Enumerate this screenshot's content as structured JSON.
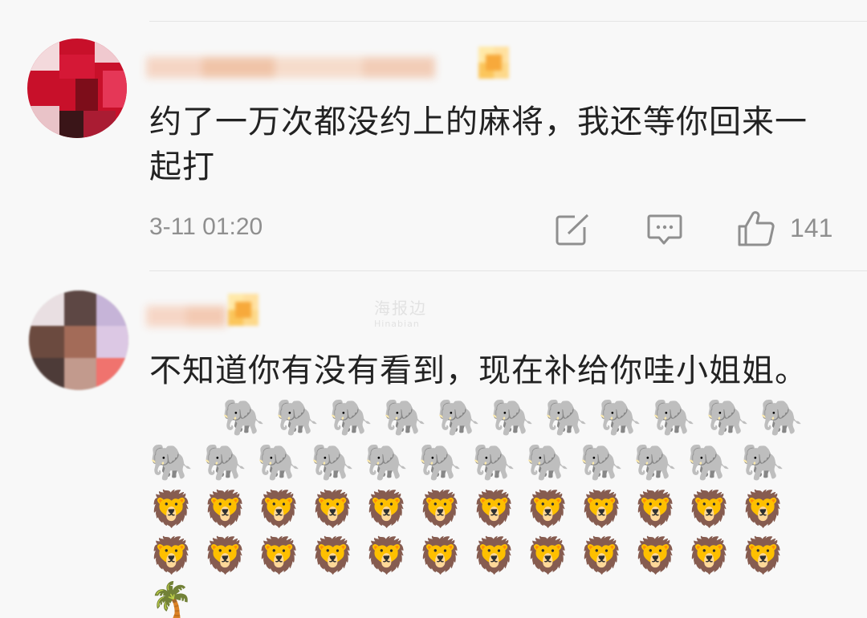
{
  "comments": [
    {
      "text": "约了一万次都没约上的麻将，我还等你回来一起打",
      "time": "3-11 01:20",
      "likes": "141"
    },
    {
      "text": "不知道你有没有看到，现在补给你哇小姐姐。"
    }
  ],
  "actions": {
    "repost_icon": "edit-square-icon",
    "comment_icon": "comment-bubble-icon",
    "like_icon": "thumbs-up-icon"
  },
  "emoji": {
    "elephant": "🐘",
    "lion": "🦁",
    "palm": "🌴"
  },
  "watermark": {
    "main": "海报边",
    "sub": "Hinabian"
  }
}
